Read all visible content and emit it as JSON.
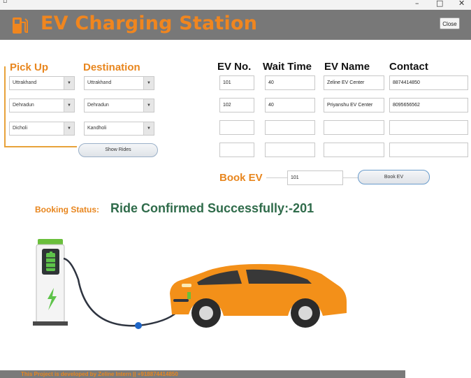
{
  "window": {
    "minimize_glyph": "–",
    "maximize_glyph": "□",
    "close_glyph": "✕"
  },
  "header": {
    "title": "EV Charging Station",
    "close_label": "Close",
    "background": "#787878",
    "accent": "#f0861f"
  },
  "pickup": {
    "heading": "Pick Up",
    "destination_heading": "Destination",
    "pickup_values": [
      "Uttrakhand",
      "Dehradun",
      "Dicholi"
    ],
    "destination_values": [
      "Uttrakhand",
      "Dehradun",
      "Kandholi"
    ],
    "show_rides_label": "Show Rides"
  },
  "table": {
    "headers": [
      "EV No.",
      "Wait Time",
      "EV Name",
      "Contact"
    ],
    "rows": [
      [
        "101",
        "40",
        "Zeline EV Center",
        "8874414850"
      ],
      [
        "102",
        "40",
        "Priyanshu EV Center",
        "8095656562"
      ],
      [
        "",
        "",
        "",
        ""
      ],
      [
        "",
        "",
        "",
        ""
      ]
    ]
  },
  "booking": {
    "label": "Book EV",
    "input_value": "101",
    "button_label": "Book EV",
    "status_label": "Booking Status:",
    "status_text": "Ride Confirmed Successfully:-201",
    "status_color": "#2f6b4a"
  },
  "footer": {
    "text": "This Project is developed by Zeline Intern || +918874414850"
  },
  "illustration": {
    "charger_icon": "ev-charger-icon",
    "car_icon": "car-icon",
    "car_color": "#f39019"
  }
}
